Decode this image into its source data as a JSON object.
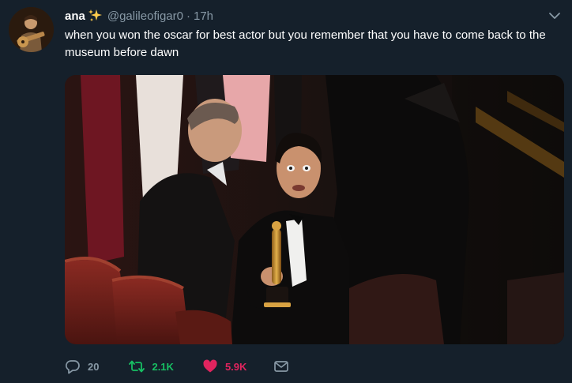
{
  "tweet": {
    "author_name": "ana",
    "author_emoji_icon": "sparkles-icon",
    "handle": "@galileofigar0",
    "separator": "·",
    "time": "17h",
    "text": "when you won the oscar for best actor but you remember that you have to come back to the museum before dawn"
  },
  "actions": {
    "reply_count": "20",
    "retweet_count": "2.1K",
    "like_count": "5.9K"
  },
  "colors": {
    "background": "#15202b",
    "secondary_text": "#8899a6",
    "retweet_active": "#17bf63",
    "like_active": "#e0245e"
  }
}
